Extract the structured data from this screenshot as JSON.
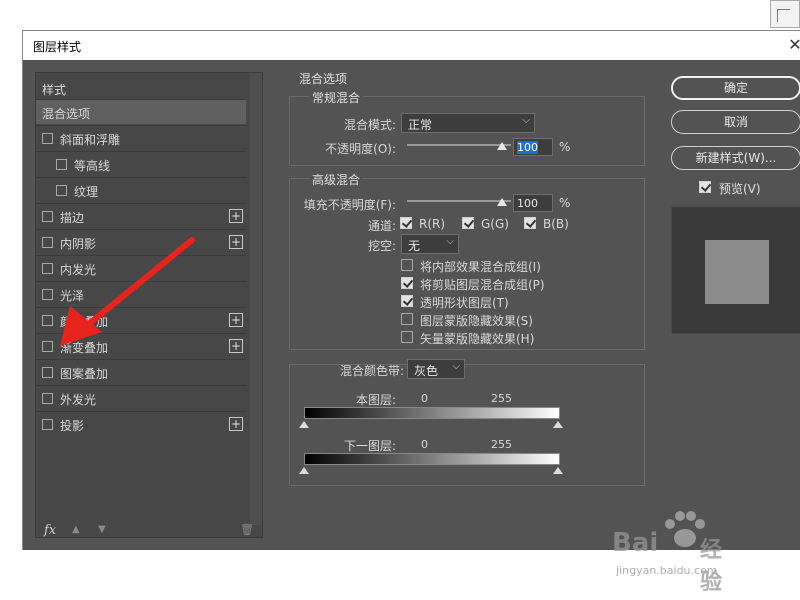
{
  "window": {
    "title": "图层样式",
    "close_glyph": "✕"
  },
  "left_panel": {
    "header": "样式",
    "items": [
      {
        "label": "混合选项",
        "checkbox": false,
        "indent": 0,
        "selected": true,
        "plus": false
      },
      {
        "label": "斜面和浮雕",
        "checkbox": true,
        "indent": 0,
        "selected": false,
        "plus": false
      },
      {
        "label": "等高线",
        "checkbox": true,
        "indent": 1,
        "selected": false,
        "plus": false
      },
      {
        "label": "纹理",
        "checkbox": true,
        "indent": 1,
        "selected": false,
        "plus": false
      },
      {
        "label": "描边",
        "checkbox": true,
        "indent": 0,
        "selected": false,
        "plus": true
      },
      {
        "label": "内阴影",
        "checkbox": true,
        "indent": 0,
        "selected": false,
        "plus": true
      },
      {
        "label": "内发光",
        "checkbox": true,
        "indent": 0,
        "selected": false,
        "plus": false
      },
      {
        "label": "光泽",
        "checkbox": true,
        "indent": 0,
        "selected": false,
        "plus": false
      },
      {
        "label": "颜色叠加",
        "checkbox": true,
        "indent": 0,
        "selected": false,
        "plus": true
      },
      {
        "label": "渐变叠加",
        "checkbox": true,
        "indent": 0,
        "selected": false,
        "plus": true
      },
      {
        "label": "图案叠加",
        "checkbox": true,
        "indent": 0,
        "selected": false,
        "plus": false
      },
      {
        "label": "外发光",
        "checkbox": true,
        "indent": 0,
        "selected": false,
        "plus": false
      },
      {
        "label": "投影",
        "checkbox": true,
        "indent": 0,
        "selected": false,
        "plus": true
      }
    ],
    "plus_glyph": "+",
    "footer": {
      "fx": "fx",
      "up": "▲",
      "down": "▼",
      "trash": "🗑"
    }
  },
  "blend_options": {
    "title": "混合选项",
    "general": {
      "title": "常规混合",
      "mode_label": "混合模式:",
      "mode_value": "正常",
      "opacity_label": "不透明度(O):",
      "opacity_value": "100",
      "opacity_unit": "%"
    },
    "advanced": {
      "title": "高级混合",
      "fill_label": "填充不透明度(F):",
      "fill_value": "100",
      "fill_unit": "%",
      "channels_label": "通道:",
      "channels": [
        {
          "label": "R(R)",
          "checked": true
        },
        {
          "label": "G(G)",
          "checked": true
        },
        {
          "label": "B(B)",
          "checked": true
        }
      ],
      "knockout_label": "挖空:",
      "knockout_value": "无",
      "options": [
        {
          "label": "将内部效果混合成组(I)",
          "checked": false
        },
        {
          "label": "将剪贴图层混合成组(P)",
          "checked": true
        },
        {
          "label": "透明形状图层(T)",
          "checked": true
        },
        {
          "label": "图层蒙版隐藏效果(S)",
          "checked": false
        },
        {
          "label": "矢量蒙版隐藏效果(H)",
          "checked": false
        }
      ]
    },
    "blend_if": {
      "label": "混合颜色带:",
      "value": "灰色",
      "this_layer_label": "本图层:",
      "this_layer_low": "0",
      "this_layer_high": "255",
      "under_layer_label": "下一图层:",
      "under_layer_low": "0",
      "under_layer_high": "255"
    }
  },
  "buttons": {
    "ok": "确定",
    "cancel": "取消",
    "new_style": "新建样式(W)...",
    "preview_label": "预览(V)",
    "preview_checked": true
  },
  "watermark": {
    "brand": "Bai",
    "brand2": "经验",
    "url": "jingyan.baidu.com"
  },
  "colors": {
    "dialog_bg": "#535353",
    "panel_bg": "#474747",
    "selected_bg": "#606060",
    "annotation_arrow": "#e8231d",
    "highlight": "#2a6fbf"
  }
}
